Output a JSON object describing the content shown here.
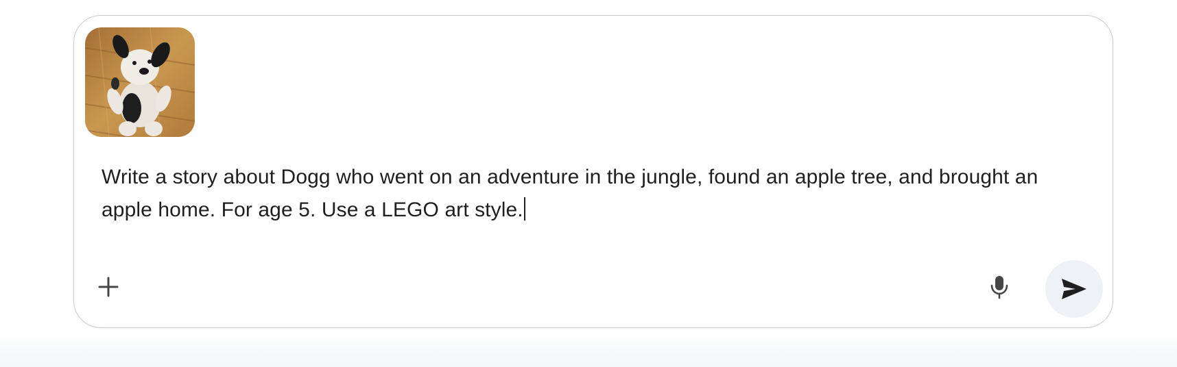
{
  "composer": {
    "attachment": {
      "alt": "Plush toy dog on a wooden floor",
      "thumbnail_icon": "plush-dog-photo"
    },
    "prompt_text": "Write a story about Dogg who went on an adventure in the jungle, found an apple tree, and brought an apple home. For age 5. Use a LEGO art style.",
    "add_icon": "plus-icon",
    "mic_icon": "microphone-icon",
    "send_icon": "send-icon",
    "colors": {
      "text": "#1f1f1f",
      "border": "#c8cbd0",
      "send_bg": "#eef2f7",
      "icon": "#444746"
    }
  }
}
